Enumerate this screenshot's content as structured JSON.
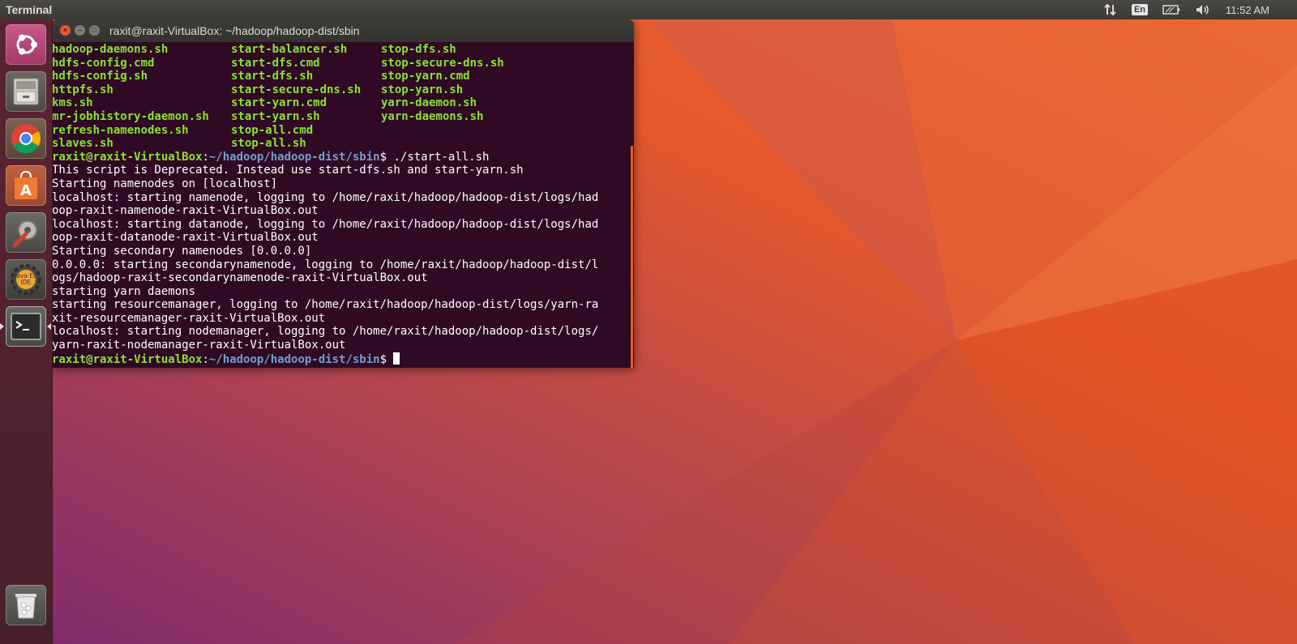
{
  "panel": {
    "app_title": "Terminal",
    "keyboard_layout": "En",
    "clock": "11:52 AM",
    "icons": [
      "network-updown-icon",
      "keyboard-layout-icon",
      "battery-icon",
      "volume-icon"
    ]
  },
  "launcher": {
    "items": [
      {
        "name": "ubuntu-dash",
        "icon": "ubuntu-logo-icon"
      },
      {
        "name": "files",
        "icon": "file-cabinet-icon"
      },
      {
        "name": "chrome",
        "icon": "chrome-icon"
      },
      {
        "name": "software-center",
        "icon": "shopping-bag-icon"
      },
      {
        "name": "system-settings",
        "icon": "wrench-gear-icon"
      },
      {
        "name": "java-ee-ide",
        "icon": "eclipse-gear-icon",
        "label": "Java EE IDE"
      },
      {
        "name": "terminal",
        "icon": "terminal-icon",
        "active": true
      },
      {
        "name": "trash",
        "icon": "trash-icon"
      }
    ]
  },
  "terminal": {
    "window_title": "raxit@raxit-VirtualBox: ~/hadoop/hadoop-dist/sbin",
    "file_listing": [
      [
        "hadoop-daemons.sh",
        "start-balancer.sh",
        "stop-dfs.sh"
      ],
      [
        "hdfs-config.cmd",
        "start-dfs.cmd",
        "stop-secure-dns.sh"
      ],
      [
        "hdfs-config.sh",
        "start-dfs.sh",
        "stop-yarn.cmd"
      ],
      [
        "httpfs.sh",
        "start-secure-dns.sh",
        "stop-yarn.sh"
      ],
      [
        "kms.sh",
        "start-yarn.cmd",
        "yarn-daemon.sh"
      ],
      [
        "mr-jobhistory-daemon.sh",
        "start-yarn.sh",
        "yarn-daemons.sh"
      ],
      [
        "refresh-namenodes.sh",
        "stop-all.cmd",
        ""
      ],
      [
        "slaves.sh",
        "stop-all.sh",
        ""
      ]
    ],
    "prompt_user": "raxit@raxit-VirtualBox",
    "prompt_path": "~/hadoop/hadoop-dist/sbin",
    "command": " ./start-all.sh",
    "output_lines": [
      "This script is Deprecated. Instead use start-dfs.sh and start-yarn.sh",
      "Starting namenodes on [localhost]",
      "localhost: starting namenode, logging to /home/raxit/hadoop/hadoop-dist/logs/had",
      "oop-raxit-namenode-raxit-VirtualBox.out",
      "localhost: starting datanode, logging to /home/raxit/hadoop/hadoop-dist/logs/had",
      "oop-raxit-datanode-raxit-VirtualBox.out",
      "Starting secondary namenodes [0.0.0.0]",
      "0.0.0.0: starting secondarynamenode, logging to /home/raxit/hadoop/hadoop-dist/l",
      "ogs/hadoop-raxit-secondarynamenode-raxit-VirtualBox.out",
      "starting yarn daemons",
      "starting resourcemanager, logging to /home/raxit/hadoop/hadoop-dist/logs/yarn-ra",
      "xit-resourcemanager-raxit-VirtualBox.out",
      "localhost: starting nodemanager, logging to /home/raxit/hadoop/hadoop-dist/logs/",
      "yarn-raxit-nodemanager-raxit-VirtualBox.out"
    ],
    "colors": {
      "background": "#300a24",
      "filename_green": "#8ae234",
      "path_blue": "#729fcf",
      "text": "#ffffff"
    }
  }
}
